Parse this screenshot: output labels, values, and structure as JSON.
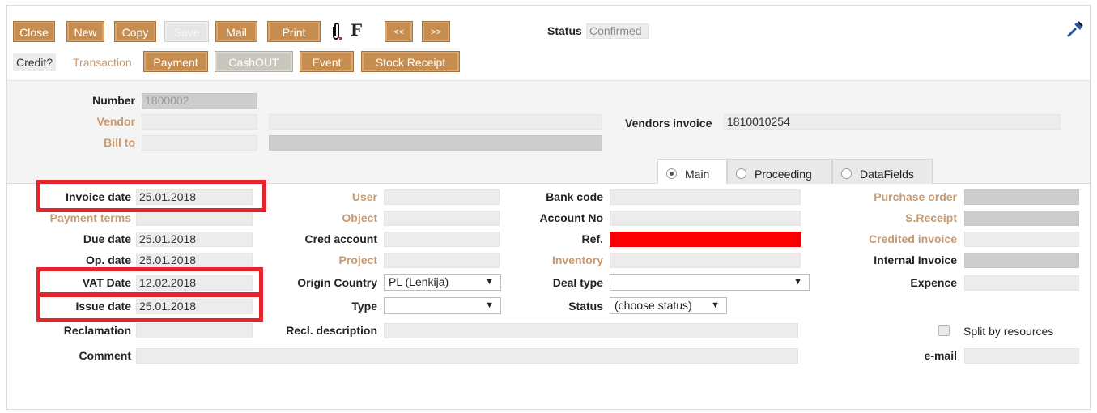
{
  "toolbar": {
    "close": "Close",
    "new": "New",
    "copy": "Copy",
    "save": "Save",
    "mail": "Mail",
    "print": "Print",
    "attach_icon": "paperclip-icon",
    "f_label": "F",
    "prev": "<<",
    "next": ">>",
    "status_label": "Status",
    "status_value": "Confirmed",
    "tools_icon": "hammer-icon"
  },
  "toolbar2": {
    "credit": "Credit?",
    "transaction": "Transaction",
    "payment": "Payment",
    "cashout": "CashOUT",
    "event": "Event",
    "stock_receipt": "Stock Receipt"
  },
  "header": {
    "number_label": "Number",
    "number_value": "1800002",
    "vendor_label": "Vendor",
    "vendor_value": "",
    "vendor_name": "",
    "billto_label": "Bill to",
    "billto_value": "",
    "billto_name": "",
    "vendors_invoice_label": "Vendors invoice",
    "vendors_invoice_value": "1810010254"
  },
  "tabs": [
    {
      "label": "Main",
      "selected": true
    },
    {
      "label": "Proceeding",
      "selected": false
    },
    {
      "label": "DataFields",
      "selected": false
    }
  ],
  "col1": {
    "invoice_date_label": "Invoice date",
    "invoice_date": "25.01.2018",
    "payment_terms_label": "Payment terms",
    "payment_terms": "",
    "due_date_label": "Due date",
    "due_date": "25.01.2018",
    "op_date_label": "Op. date",
    "op_date": "25.01.2018",
    "vat_date_label": "VAT Date",
    "vat_date": "12.02.2018",
    "issue_date_label": "Issue date",
    "issue_date": "25.01.2018",
    "reclamation_label": "Reclamation",
    "reclamation": "",
    "comment_label": "Comment",
    "comment": ""
  },
  "col2": {
    "user_label": "User",
    "user": "",
    "object_label": "Object",
    "object": "",
    "cred_account_label": "Cred account",
    "cred_account": "",
    "project_label": "Project",
    "project": "",
    "origin_country_label": "Origin Country",
    "origin_country": "PL (Lenkija)",
    "type_label": "Type",
    "type": "",
    "recl_description_label": "Recl. description",
    "recl_description": ""
  },
  "col3": {
    "bank_code_label": "Bank code",
    "bank_code": "",
    "account_no_label": "Account No",
    "account_no": "",
    "ref_label": "Ref.",
    "ref": "",
    "inventory_label": "Inventory",
    "inventory": "",
    "deal_type_label": "Deal type",
    "deal_type": "",
    "status_label": "Status",
    "status": "(choose status)"
  },
  "col4": {
    "purchase_order_label": "Purchase order",
    "purchase_order": "",
    "s_receipt_label": "S.Receipt",
    "s_receipt": "",
    "credited_invoice_label": "Credited invoice",
    "credited_invoice": "",
    "internal_invoice_label": "Internal Invoice",
    "internal_invoice": "",
    "expence_label": "Expence",
    "expence": "",
    "split_by_resources_label": "Split by resources",
    "split_by_resources": false,
    "email_label": "e-mail",
    "email": ""
  },
  "colors": {
    "button": "#c78d4f",
    "link_label": "#c99a6f",
    "highlight": "#e2262b",
    "ref_error": "#fb0000"
  }
}
